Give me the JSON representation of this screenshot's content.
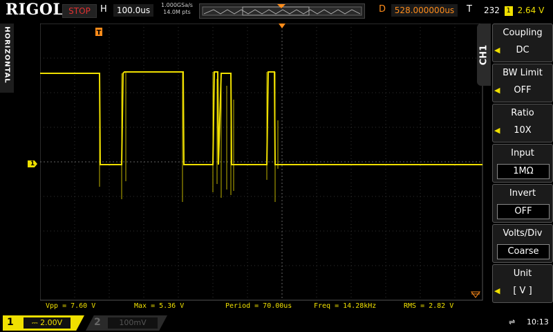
{
  "header": {
    "logo": "RIGOL",
    "run_status": "STOP",
    "h_label": "H",
    "timebase": "100.0us",
    "sample_rate": "1.000GSa/s",
    "memory_depth": "14.0M pts",
    "delay_label": "D",
    "delay": "528.000000us",
    "trigger_label": "T",
    "trigger_count": "232",
    "trigger_source": "1",
    "trigger_level": "2.64 V"
  },
  "left_tab": "HORIZONTAL",
  "menu": {
    "channel_tab": "CH1",
    "items": [
      {
        "title": "Coupling",
        "value": "DC"
      },
      {
        "title": "BW Limit",
        "value": "OFF"
      },
      {
        "title": "Ratio",
        "value": "10X"
      },
      {
        "title": "Input",
        "value": "1MΩ"
      },
      {
        "title": "Invert",
        "value": "OFF"
      },
      {
        "title": "Volts/Div",
        "value": "Coarse"
      },
      {
        "title": "Unit",
        "value": "[ V ]"
      }
    ]
  },
  "measurements": [
    "Vpp = 7.60 V",
    "Max = 5.36 V",
    "Period = 70.00us",
    "Freq = 14.28kHz",
    "RMS = 2.82 V"
  ],
  "footer": {
    "ch1_number": "1",
    "ch1_scale": "2.00V",
    "ch2_number": "2",
    "ch2_scale": "100mV",
    "time": "10:13"
  },
  "colors": {
    "ch1": "#f0e000",
    "delay": "#ff8c1a",
    "stop": "#e03030"
  }
}
